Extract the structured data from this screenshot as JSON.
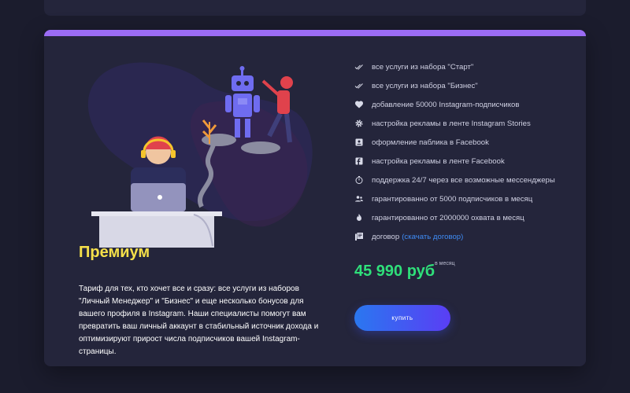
{
  "plan": {
    "title": "Премиум",
    "description": "Тариф для тех, кто хочет все и сразу: все услуги из наборов \"Личный Менеджер\" и \"Бизнес\" и еще несколько бонусов для вашего профиля в Instagram. Наши специалисты помогут вам превратить ваш личный аккаунт в стабильный источник дохода и оптимизируют прирост числа подписчиков вашей Instagram- страницы.",
    "price": "45 990 руб",
    "price_period": "в месяц",
    "buy_label": "купить",
    "accent_color": "#9b6cf4",
    "title_color": "#f5e04a",
    "price_color": "#2fe07a"
  },
  "features": [
    {
      "icon": "double-check-icon",
      "text": "все услуги из набора \"Старт\""
    },
    {
      "icon": "double-check-icon",
      "text": "все услуги из набора \"Бизнес\""
    },
    {
      "icon": "heart-icon",
      "text": "добавление 50000 Instagram-подписчиков"
    },
    {
      "icon": "gear-icon",
      "text": "настройка рекламы в ленте Instagram Stories"
    },
    {
      "icon": "account-box-icon",
      "text": "оформление паблика в Facebook"
    },
    {
      "icon": "facebook-icon",
      "text": "настройка рекламы в ленте Facebook"
    },
    {
      "icon": "timer-icon",
      "text": "поддержка 24/7 через все возможные мессенджеры"
    },
    {
      "icon": "people-icon",
      "text": "гарантированно от 5000 подписчиков в месяц"
    },
    {
      "icon": "fire-icon",
      "text": "гарантированно от 2000000 охвата в месяц"
    },
    {
      "icon": "documents-icon",
      "text": "договор",
      "link": "(скачать договор)"
    }
  ]
}
